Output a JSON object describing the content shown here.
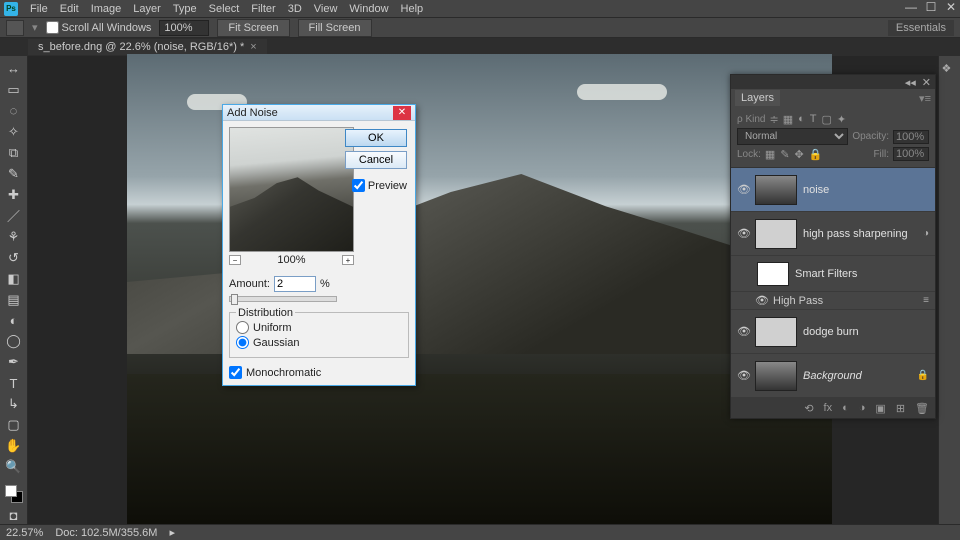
{
  "menu": {
    "items": [
      "File",
      "Edit",
      "Image",
      "Layer",
      "Type",
      "Select",
      "Filter",
      "3D",
      "View",
      "Window",
      "Help"
    ]
  },
  "options_bar": {
    "scroll_all": "Scroll All Windows",
    "zoom_value": "100%",
    "fit_screen": "Fit Screen",
    "fill_screen": "Fill Screen"
  },
  "workspace_label": "Essentials",
  "document_tab": {
    "title": "s_before.dng @ 22.6% (noise, RGB/16*) *"
  },
  "dialog": {
    "title": "Add Noise",
    "ok": "OK",
    "cancel": "Cancel",
    "preview_label": "Preview",
    "zoom_text": "100%",
    "amount_label": "Amount:",
    "amount_value": "2",
    "amount_unit": "%",
    "distribution_legend": "Distribution",
    "uniform": "Uniform",
    "gaussian": "Gaussian",
    "monochromatic": "Monochromatic"
  },
  "layers": {
    "tab": "Layers",
    "kind_label": "ρ Kind",
    "blend_mode": "Normal",
    "opacity_label": "Opacity:",
    "opacity_value": "100%",
    "lock_label": "Lock:",
    "fill_label": "Fill:",
    "fill_value": "100%",
    "items": [
      {
        "name": "noise"
      },
      {
        "name": "high pass sharpening"
      },
      {
        "name": "Smart Filters"
      },
      {
        "name": "High Pass"
      },
      {
        "name": "dodge burn"
      },
      {
        "name": "Background"
      }
    ]
  },
  "statusbar": {
    "zoom": "22.57%",
    "docinfo": "Doc: 102.5M/355.6M"
  }
}
